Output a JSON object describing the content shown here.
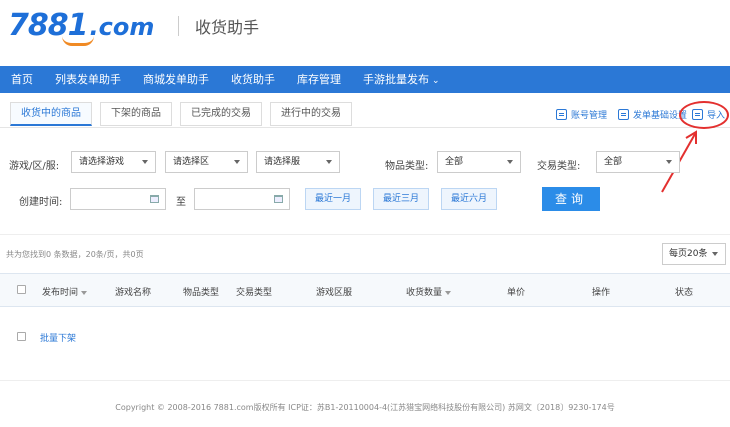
{
  "header": {
    "logo_number": "7881",
    "logo_suffix": ".com",
    "title": "收货助手"
  },
  "nav": [
    {
      "label": "首页"
    },
    {
      "label": "列表发单助手"
    },
    {
      "label": "商城发单助手"
    },
    {
      "label": "收货助手"
    },
    {
      "label": "库存管理"
    },
    {
      "label": "手游批量发布"
    }
  ],
  "tabs": [
    {
      "label": "收货中的商品",
      "active": true
    },
    {
      "label": "下架的商品"
    },
    {
      "label": "已完成的交易"
    },
    {
      "label": "进行中的交易"
    }
  ],
  "tools": {
    "account_manage": "账号管理",
    "base_settings": "发单基础设置",
    "import": "导入"
  },
  "filters": {
    "game_label": "游戏/区/服:",
    "game_select": "请选择游戏",
    "area_select": "请选择区",
    "server_select": "请选择服",
    "goods_type_label": "物品类型:",
    "goods_type_value": "全部",
    "trade_type_label": "交易类型:",
    "trade_type_value": "全部",
    "created_label": "创建时间:",
    "to_label": "至",
    "last_month": "最近一月",
    "last_3_months": "最近三月",
    "last_6_months": "最近六月",
    "query": "查询"
  },
  "results": {
    "count_text": "共为您找到0 条数据，20条/页，共0页",
    "page_size": "每页20条"
  },
  "table": {
    "headers": [
      "发布时间",
      "游戏名称",
      "物品类型",
      "交易类型",
      "游戏区服",
      "收货数量",
      "单价",
      "操作",
      "状态"
    ]
  },
  "batch": {
    "label": "批量下架"
  },
  "footer": {
    "text": "Copyright © 2008-2016 7881.com版权所有 ICP证：苏B1-20110004-4(江苏猎宝网络科技股份有限公司) 苏网文〔2018〕9230-174号"
  },
  "colors": {
    "brand_blue": "#2b78d6",
    "logo_orange": "#f08a24",
    "annotation_red": "#e3302f"
  }
}
